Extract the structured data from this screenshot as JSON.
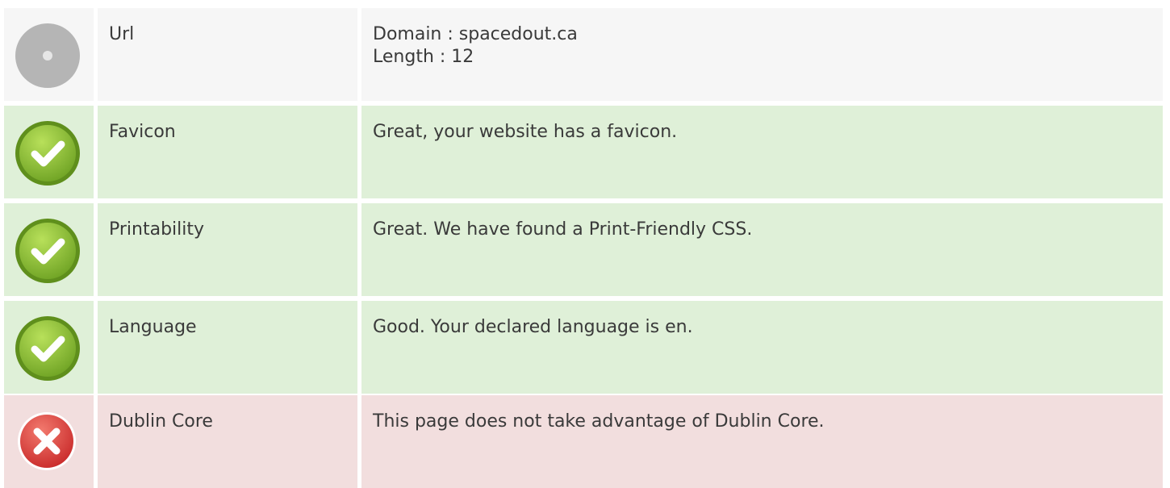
{
  "rows": [
    {
      "status": "neutral",
      "icon": "gray-circle-icon",
      "label": "Url",
      "value_lines": [
        "Domain : spacedout.ca",
        "Length : 12"
      ]
    },
    {
      "status": "good",
      "icon": "check-circle-icon",
      "label": "Favicon",
      "value_lines": [
        "Great, your website has a favicon."
      ]
    },
    {
      "status": "good",
      "icon": "check-circle-icon",
      "label": "Printability",
      "value_lines": [
        "Great. We have found a Print-Friendly CSS."
      ]
    },
    {
      "status": "good",
      "icon": "check-circle-icon",
      "label": "Language",
      "value_lines": [
        "Good. Your declared language is en."
      ]
    },
    {
      "status": "bad",
      "icon": "error-x-circle-icon",
      "label": "Dublin Core",
      "value_lines": [
        "This page does not take advantage of Dublin Core."
      ]
    }
  ],
  "colors": {
    "neutral_bg": "#f6f6f6",
    "good_bg": "#dff0d8",
    "bad_bg": "#f2dede",
    "check_green": "#8cc63f",
    "error_red": "#e04a4a",
    "neutral_gray": "#b5b5b5"
  }
}
